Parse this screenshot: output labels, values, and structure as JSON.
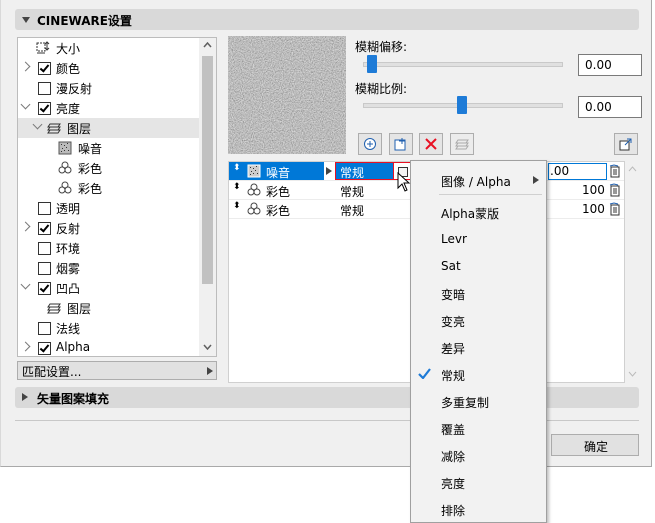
{
  "window": {
    "section_title": "CINEWARE设置",
    "footer_section_title": "矢量图案填充",
    "ok_label": "确定"
  },
  "tree": {
    "items": [
      {
        "label": "大小"
      },
      {
        "label": "颜色"
      },
      {
        "label": "漫反射"
      },
      {
        "label": "亮度"
      },
      {
        "label": "图层"
      },
      {
        "label": "噪音"
      },
      {
        "label": "彩色"
      },
      {
        "label": "彩色"
      },
      {
        "label": "透明"
      },
      {
        "label": "反射"
      },
      {
        "label": "环境"
      },
      {
        "label": "烟雾"
      },
      {
        "label": "凹凸"
      },
      {
        "label": "图层"
      },
      {
        "label": "法线"
      },
      {
        "label": "Alpha"
      }
    ],
    "match_settings_label": "匹配设置..."
  },
  "params": {
    "blur_offset_label": "模糊偏移:",
    "blur_offset_value": "0.00",
    "blur_scale_label": "模糊比例:",
    "blur_scale_value": "0.00",
    "blur_offset_position": 0.02,
    "blur_scale_position": 0.5
  },
  "layers": {
    "rows": [
      {
        "name": "噪音",
        "mode": "常规",
        "value": ".00"
      },
      {
        "name": "彩色",
        "mode": "常规",
        "value": "100"
      },
      {
        "name": "彩色",
        "mode": "常规",
        "value": "100"
      }
    ]
  },
  "blend_menu": {
    "items": [
      {
        "label": "图像 / Alpha"
      },
      {
        "label": "Alpha蒙版"
      },
      {
        "label": "Levr"
      },
      {
        "label": "Sat"
      },
      {
        "label": "变暗"
      },
      {
        "label": "变亮"
      },
      {
        "label": "差异"
      },
      {
        "label": "常规"
      },
      {
        "label": "多重复制"
      },
      {
        "label": "覆盖"
      },
      {
        "label": "减除"
      },
      {
        "label": "亮度"
      },
      {
        "label": "排除"
      }
    ],
    "checked_index": 7
  },
  "colors": {
    "accent": "#1e7bd7",
    "selection": "#0078d7",
    "delete_red": "#e81123",
    "highlight_border": "#e81123"
  }
}
